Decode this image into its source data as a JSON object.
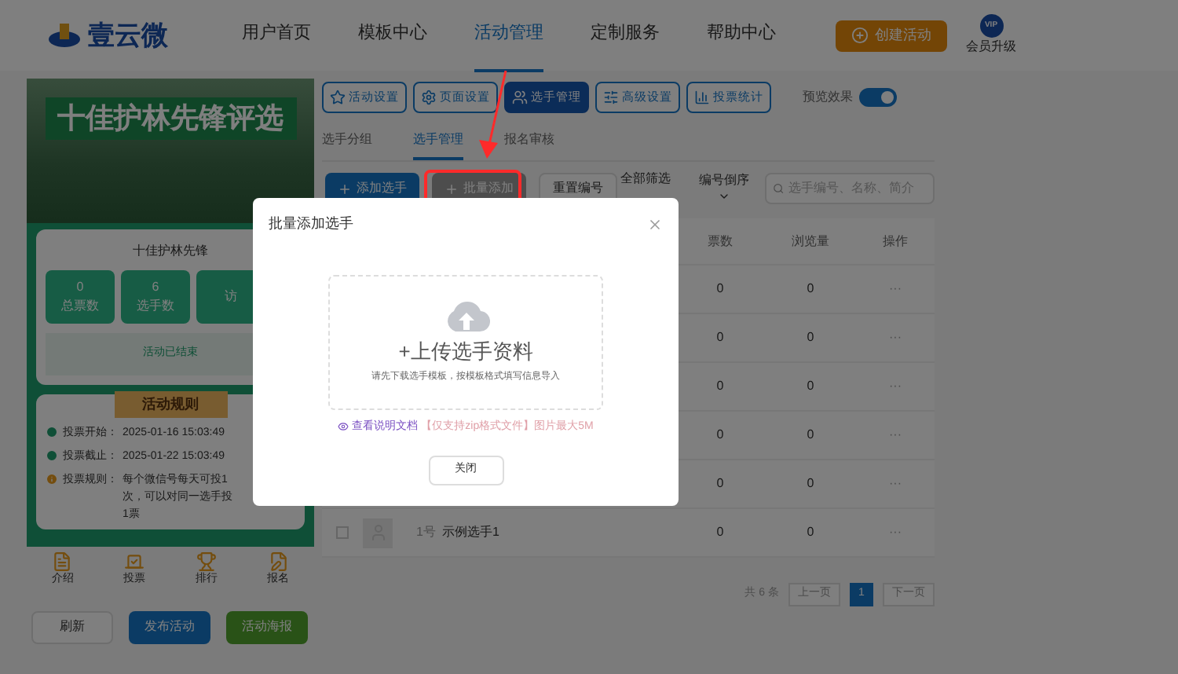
{
  "header": {
    "logo": "壹云微",
    "nav": [
      {
        "label": "用户首页",
        "selected": false
      },
      {
        "label": "模板中心",
        "selected": false
      },
      {
        "label": "活动管理",
        "selected": true
      },
      {
        "label": "定制服务",
        "selected": false
      },
      {
        "label": "帮助中心",
        "selected": false
      }
    ],
    "create_button": "创建活动",
    "vip_badge": "VIP",
    "vip_label": "会员升级"
  },
  "preview": {
    "banner_title": "十佳护林先锋评选",
    "subtitle": "十佳护林先锋",
    "stats": [
      {
        "value": "0",
        "label": "总票数"
      },
      {
        "value": "6",
        "label": "选手数"
      },
      {
        "label": "访"
      }
    ],
    "status": "活动已结束",
    "rules_title": "活动规则",
    "rules": [
      {
        "label": "投票开始：",
        "text": "2025-01-16 15:03:49",
        "kind": "time"
      },
      {
        "label": "投票截止：",
        "text": "2025-01-22 15:03:49",
        "kind": "time"
      },
      {
        "label": "投票规则：",
        "text": "每个微信号每天可投1次，可以对同一选手投1票",
        "kind": "rule"
      }
    ],
    "tabs": [
      {
        "label": "介绍",
        "kind": "intro"
      },
      {
        "label": "投票",
        "kind": "vote"
      },
      {
        "label": "排行",
        "kind": "rank"
      },
      {
        "label": "报名",
        "kind": "signup"
      }
    ]
  },
  "bottom_buttons": [
    {
      "label": "刷新",
      "kind": "plain"
    },
    {
      "label": "发布活动",
      "kind": "primary"
    },
    {
      "label": "活动海报",
      "kind": "success"
    }
  ],
  "toolbar": [
    {
      "label": "活动设置",
      "kind": "star",
      "selected": false
    },
    {
      "label": "页面设置",
      "kind": "gear",
      "selected": false
    },
    {
      "label": "选手管理",
      "kind": "users",
      "selected": true
    },
    {
      "label": "高级设置",
      "kind": "sliders",
      "selected": false
    },
    {
      "label": "投票统计",
      "kind": "chart",
      "selected": false
    }
  ],
  "preview_toggle": {
    "label": "预览效果",
    "on": true
  },
  "sub_tabs": [
    {
      "label": "选手分组",
      "selected": false
    },
    {
      "label": "选手管理",
      "selected": true
    },
    {
      "label": "报名审核",
      "selected": false
    }
  ],
  "actions": {
    "add_button": "添加选手",
    "batch_button": "批量添加",
    "reset_button": "重置编号",
    "filter": "全部筛选",
    "sort": "编号倒序",
    "search": {
      "placeholder": "选手编号、名称、简介"
    }
  },
  "table": {
    "columns": [
      "票数",
      "浏览量",
      "操作"
    ],
    "rows": [
      {
        "votes": "0",
        "views": "0",
        "action": "···"
      },
      {
        "votes": "0",
        "views": "0",
        "action": "···"
      },
      {
        "votes": "0",
        "views": "0",
        "action": "···"
      },
      {
        "votes": "0",
        "views": "0",
        "action": "···"
      },
      {
        "votes": "0",
        "views": "0",
        "action": "···"
      },
      {
        "checked": false,
        "number": "1号",
        "name": "示例选手1",
        "votes": "0",
        "views": "0",
        "action": "···"
      }
    ]
  },
  "pagination": {
    "total": "共 6 条",
    "prev": "上一页",
    "pages": [
      {
        "label": "1",
        "selected": true
      }
    ],
    "next": "下一页"
  },
  "dialog": {
    "title": "批量添加选手",
    "upload_title": "+上传选手资料",
    "upload_hint": "请先下载选手模板，按模板格式填写信息导入",
    "doc_link": "查看说明文档",
    "note": "【仅支持zip格式文件】图片最大5M",
    "close_button": "关闭"
  }
}
